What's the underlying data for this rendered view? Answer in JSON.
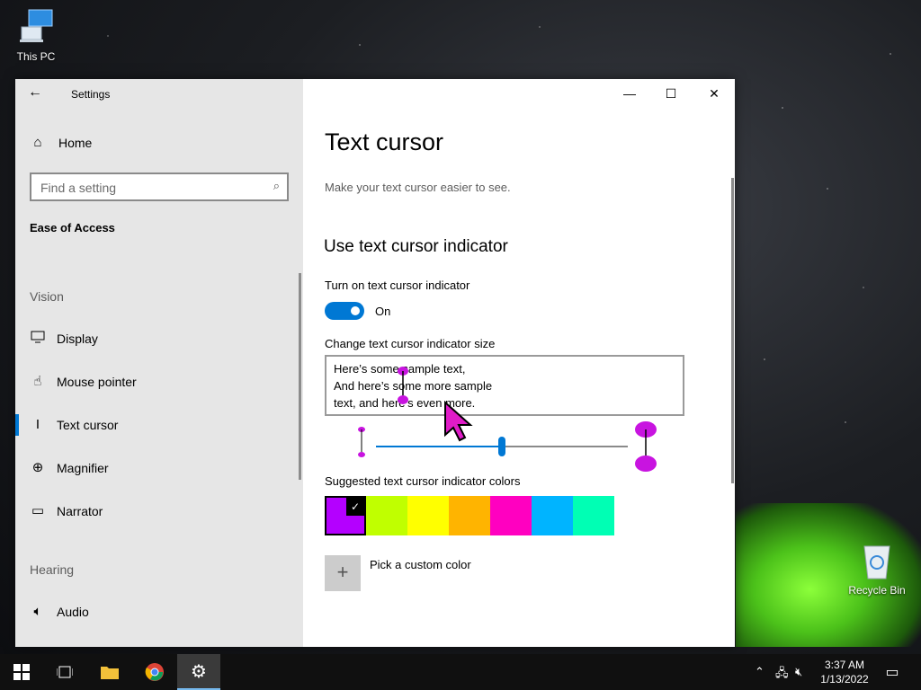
{
  "desktop": {
    "this_pc_label": "This PC",
    "recycle_bin_label": "Recycle Bin"
  },
  "window": {
    "title": "Settings",
    "minimize_glyph": "—",
    "maximize_glyph": "☐",
    "close_glyph": "✕"
  },
  "sidebar": {
    "home_label": "Home",
    "search_placeholder": "Find a setting",
    "current_section": "Ease of Access",
    "groups": [
      {
        "header": "Vision",
        "items": [
          {
            "label": "Display",
            "icon": "monitor-icon"
          },
          {
            "label": "Mouse pointer",
            "icon": "pointer-icon"
          },
          {
            "label": "Text cursor",
            "icon": "text-cursor-icon",
            "active": true
          },
          {
            "label": "Magnifier",
            "icon": "magnifier-icon"
          },
          {
            "label": "Narrator",
            "icon": "narrator-icon"
          }
        ]
      },
      {
        "header": "Hearing",
        "items": [
          {
            "label": "Audio",
            "icon": "speaker-icon"
          }
        ]
      }
    ]
  },
  "main": {
    "title": "Text cursor",
    "description": "Make your text cursor easier to see.",
    "section_title": "Use text cursor indicator",
    "toggle_label": "Turn on text cursor indicator",
    "toggle_state": "On",
    "toggle_on": true,
    "size_label": "Change text cursor indicator size",
    "sample_lines": [
      "Here’s some sample text,",
      "And here’s some more sample",
      "text, and here’s even more."
    ],
    "size_slider_value": 0.5,
    "colors_label": "Suggested text cursor indicator colors",
    "colors": [
      "#b400ff",
      "#c0ff00",
      "#ffff00",
      "#ffb400",
      "#ff00c0",
      "#00b4ff",
      "#00ffb4"
    ],
    "selected_color_index": 0,
    "custom_color_label": "Pick a custom color",
    "indicator_color": "#c814e0"
  },
  "taskbar": {
    "time": "3:37 AM",
    "date": "1/13/2022",
    "accent": "#76b9ed"
  }
}
